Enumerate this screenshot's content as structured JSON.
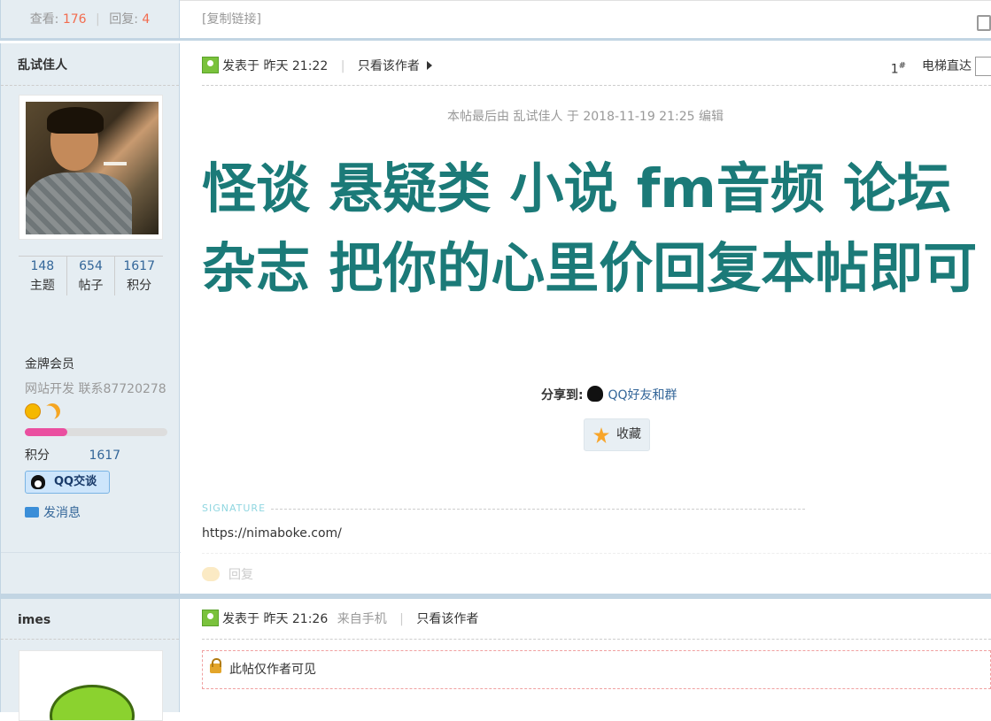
{
  "thread_stats": {
    "views_label": "查看:",
    "views": "176",
    "replies_label": "回复:",
    "replies": "4",
    "separator": "|"
  },
  "toolbar": {
    "copy_link": "[复制链接]"
  },
  "post1": {
    "author": "乱试佳人",
    "stats": [
      {
        "value": "148",
        "label": "主题"
      },
      {
        "value": "654",
        "label": "帖子"
      },
      {
        "value": "1617",
        "label": "积分"
      }
    ],
    "rank": "金牌会员",
    "custom_title": "网站开发 联系87720278",
    "level_progress_fraction": 0.3,
    "score_label": "积分",
    "score_value": "1617",
    "qq_button": "QQ交谈",
    "send_message": "发消息",
    "posted_prefix": "发表于",
    "posted_time": "昨天 21:22",
    "only_author": "只看该作者",
    "floor": "1",
    "floor_mark": "#",
    "jump_label": "电梯直达",
    "edit_note": "本帖最后由 乱试佳人 于 2018-11-19 21:25 编辑",
    "title": "怪谈 悬疑类 小说 fm音频 论坛 杂志 把你的心里价回复本帖即可",
    "share_label": "分享到:",
    "share_qq": "QQ好友和群",
    "favorite": "收藏",
    "signature_label": "SIGNATURE",
    "signature": "https://nimaboke.com/",
    "reply": "回复"
  },
  "post2": {
    "author": "imes",
    "posted_prefix": "发表于",
    "posted_time": "昨天 21:26",
    "from": "来自手机",
    "only_author": "只看该作者",
    "locked_text": "此帖仅作者可见"
  },
  "colors": {
    "title": "#1b7a78",
    "accent_number": "#f26c4f",
    "link": "#336699",
    "sidebar_bg": "#e5edf2"
  }
}
